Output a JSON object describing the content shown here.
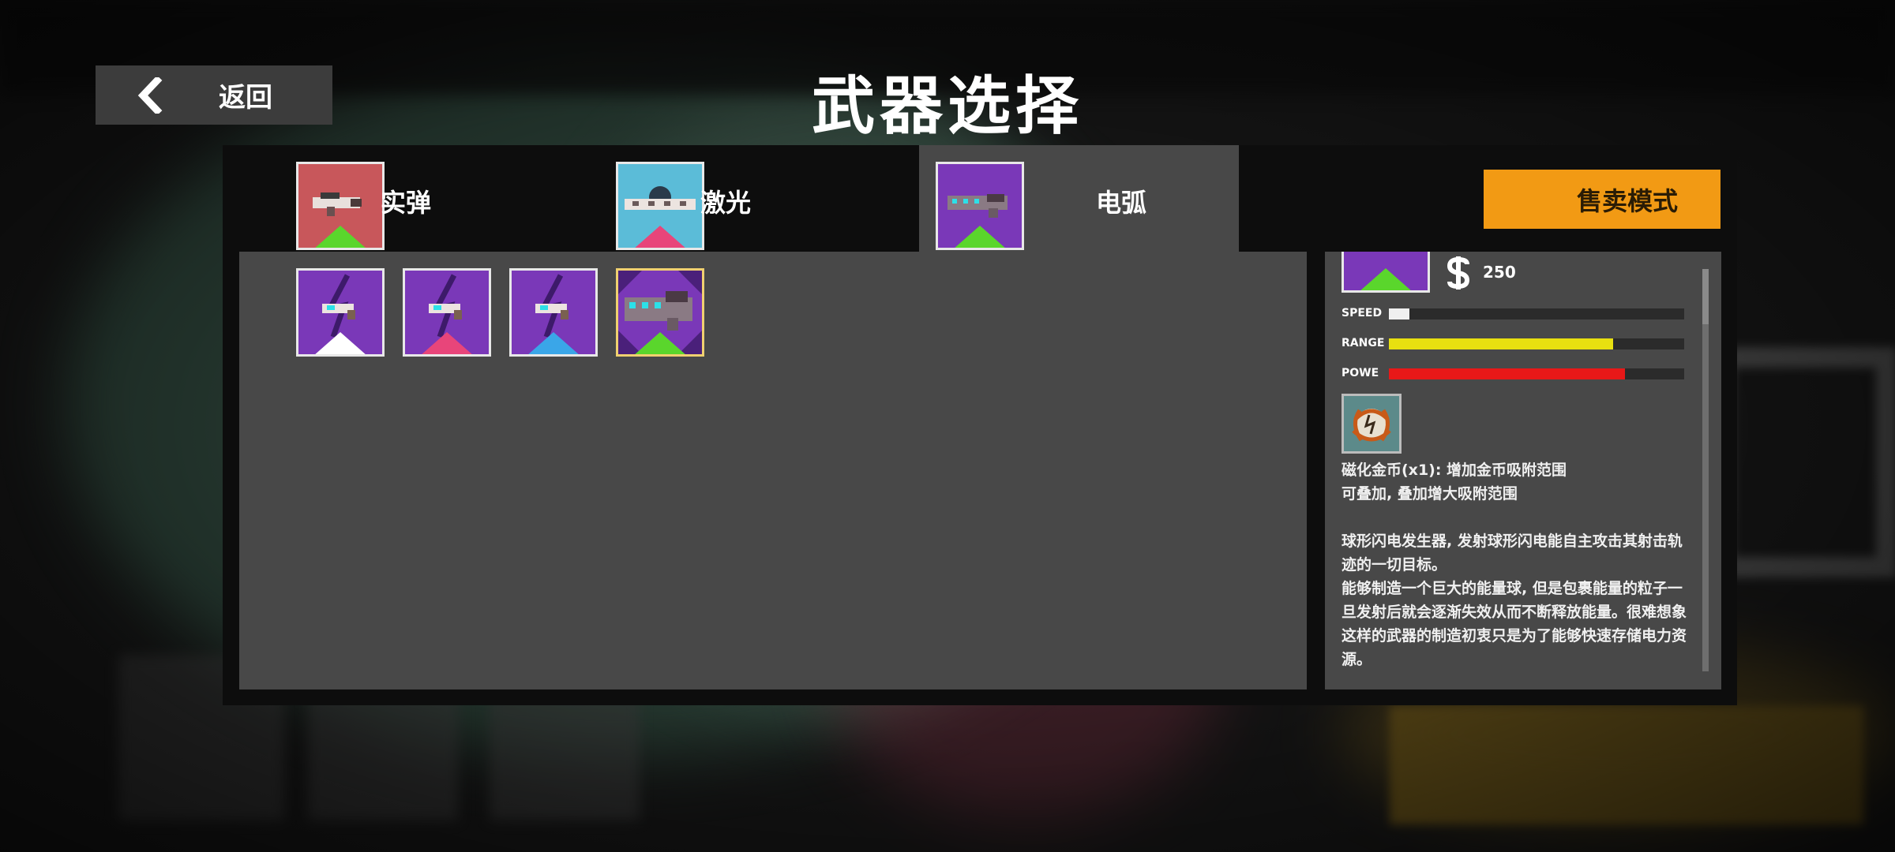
{
  "header": {
    "back_label": "返回",
    "title": "武器选择"
  },
  "tabs": [
    {
      "label": "实弹",
      "tile_color": "#c8575b",
      "tier_color": "#5ad62c"
    },
    {
      "label": "激光",
      "tile_color": "#5bbcd8",
      "tier_color": "#e8457a"
    },
    {
      "label": "电弧",
      "tile_color": "#7a38b8",
      "tier_color": "#5ad62c"
    }
  ],
  "active_tab": "电弧",
  "sell_mode_label": "售卖模式",
  "weapons": [
    {
      "tile_color": "#7a38b8",
      "tier_color": "#ffffff"
    },
    {
      "tile_color": "#7a38b8",
      "tier_color": "#e8457a"
    },
    {
      "tile_color": "#7a38b8",
      "tier_color": "#3aa6e8"
    },
    {
      "tile_color": "#7a38b8",
      "tier_color": "#5ad62c",
      "selected": true
    }
  ],
  "detail": {
    "price": "250",
    "currency_icon": "dollar-icon",
    "stats": [
      {
        "label": "SPEED",
        "value": 0.07,
        "color": "#f0f0f0"
      },
      {
        "label": "RANGE",
        "value": 0.76,
        "color": "#e8e010"
      },
      {
        "label": "POWE",
        "value": 0.8,
        "color": "#e81818"
      }
    ],
    "perk_icon": "magnet-coin-icon",
    "perk_line1": "磁化金币(x1): 增加金币吸附范围",
    "perk_line2": "可叠加, 叠加增大吸附范围",
    "desc_1": "球形闪电发生器, 发射球形闪电能自主攻击其射击轨迹的一切目标。",
    "desc_2": "能够制造一个巨大的能量球, 但是包裹能量的粒子一旦发射后就会逐渐失效从而不断释放能量。很难想象这样的武器的制造初衷只是为了能够快速存储电力资源。"
  }
}
